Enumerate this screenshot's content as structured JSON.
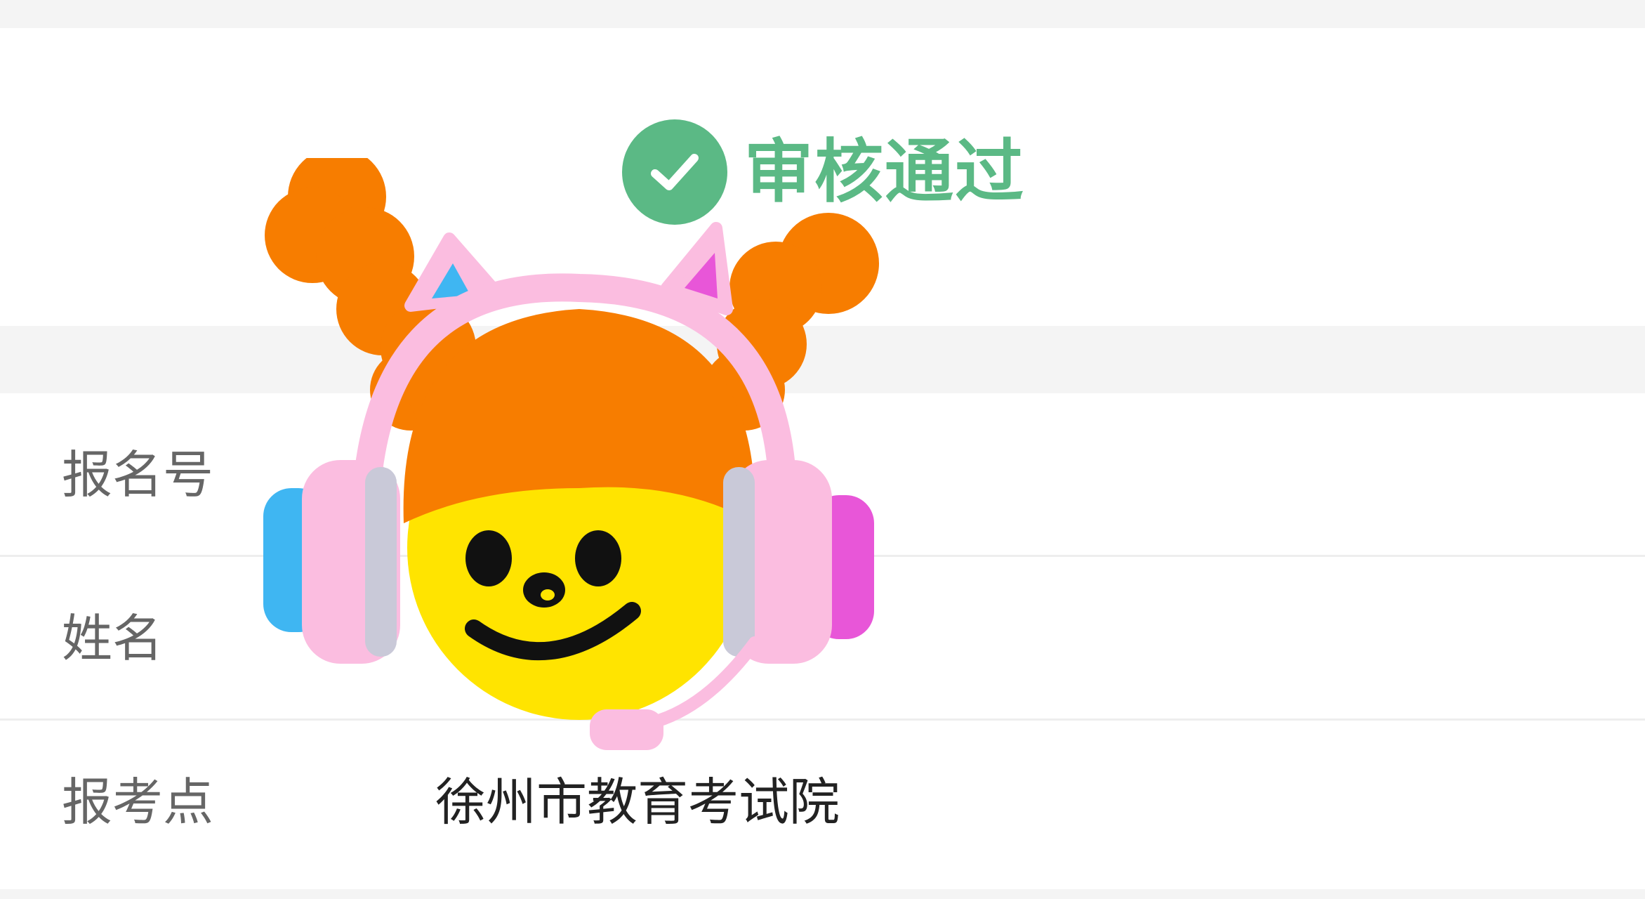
{
  "status": {
    "icon": "check-circle-icon",
    "label": "审核通过",
    "color": "#5bb985"
  },
  "info_rows": [
    {
      "label": "报名号",
      "value": ""
    },
    {
      "label": "姓名",
      "value": ""
    },
    {
      "label": "报考点",
      "value": "徐州市教育考试院"
    }
  ],
  "overlay": {
    "icon": "cartoon-avatar-with-headset-sticker"
  }
}
